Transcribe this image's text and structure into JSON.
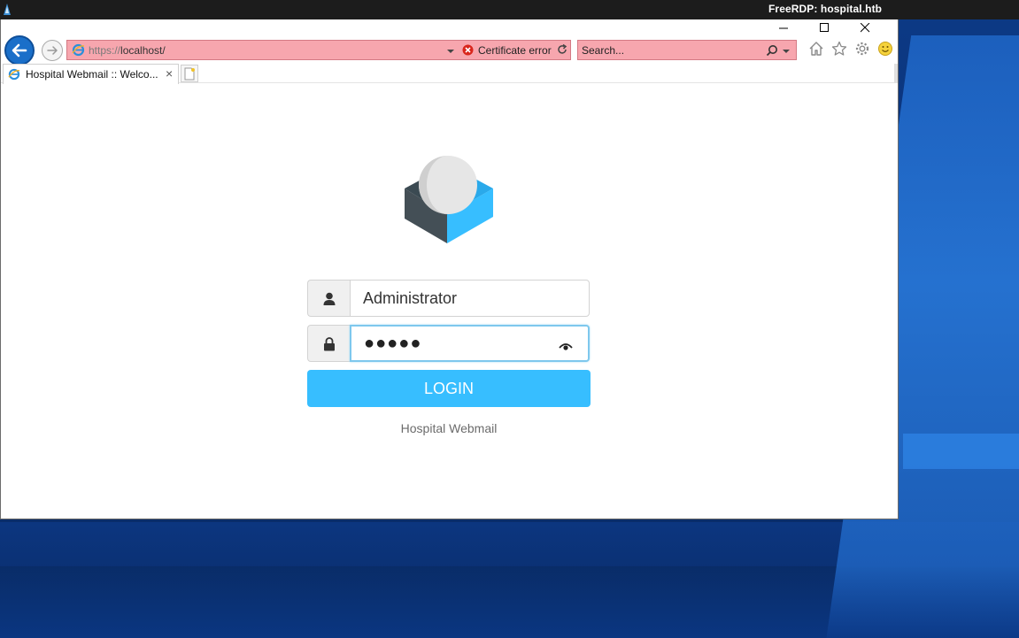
{
  "rdp": {
    "title": "FreeRDP: hospital.htb"
  },
  "browser": {
    "address_scheme": "https://",
    "address_host": "localhost/",
    "certificate_status": "Certificate error",
    "search_placeholder": "Search...",
    "tab_title": "Hospital Webmail :: Welco...",
    "tab_close": "×"
  },
  "login": {
    "username_value": "Administrator",
    "password_mask": "●●●●●",
    "login_label": "LOGIN",
    "footer": "Hospital Webmail"
  },
  "colors": {
    "address_error_bg": "#f7a6ae",
    "login_button": "#37beff",
    "rdp_bar": "#1c1c1c"
  },
  "icons": [
    "rdp-app-icon",
    "minimize-icon",
    "maximize-icon",
    "close-icon",
    "back-arrow-icon",
    "forward-arrow-icon",
    "ie-icon",
    "dropdown-icon",
    "certificate-error-icon",
    "refresh-icon",
    "search-icon",
    "home-icon",
    "favorites-star-icon",
    "settings-gear-icon",
    "feedback-smiley-icon",
    "new-tab-icon",
    "roundcube-logo",
    "user-icon",
    "lock-icon",
    "eye-icon"
  ]
}
